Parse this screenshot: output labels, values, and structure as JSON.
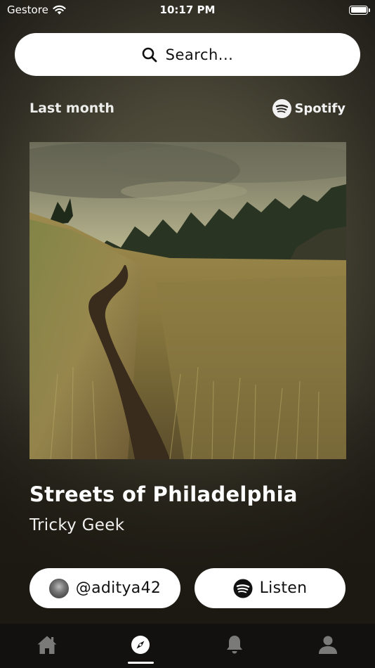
{
  "status_bar": {
    "carrier": "Gestore",
    "time": "10:17 PM"
  },
  "search": {
    "placeholder": "Search..."
  },
  "section": {
    "label": "Last month",
    "provider": "Spotify"
  },
  "track": {
    "title": "Streets of Philadelphia",
    "artist": "Tricky Geek"
  },
  "actions": {
    "user_handle": "@aditya42",
    "listen_label": "Listen"
  },
  "tab_bar": {
    "items": [
      {
        "icon": "home-icon",
        "active": false
      },
      {
        "icon": "compass-icon",
        "active": true
      },
      {
        "icon": "bell-icon",
        "active": false
      },
      {
        "icon": "person-icon",
        "active": false
      }
    ]
  },
  "colors": {
    "background": "#141210",
    "pill": "#ffffff",
    "tab_bar": "#121110",
    "tab_inactive": "#7a7a78"
  }
}
